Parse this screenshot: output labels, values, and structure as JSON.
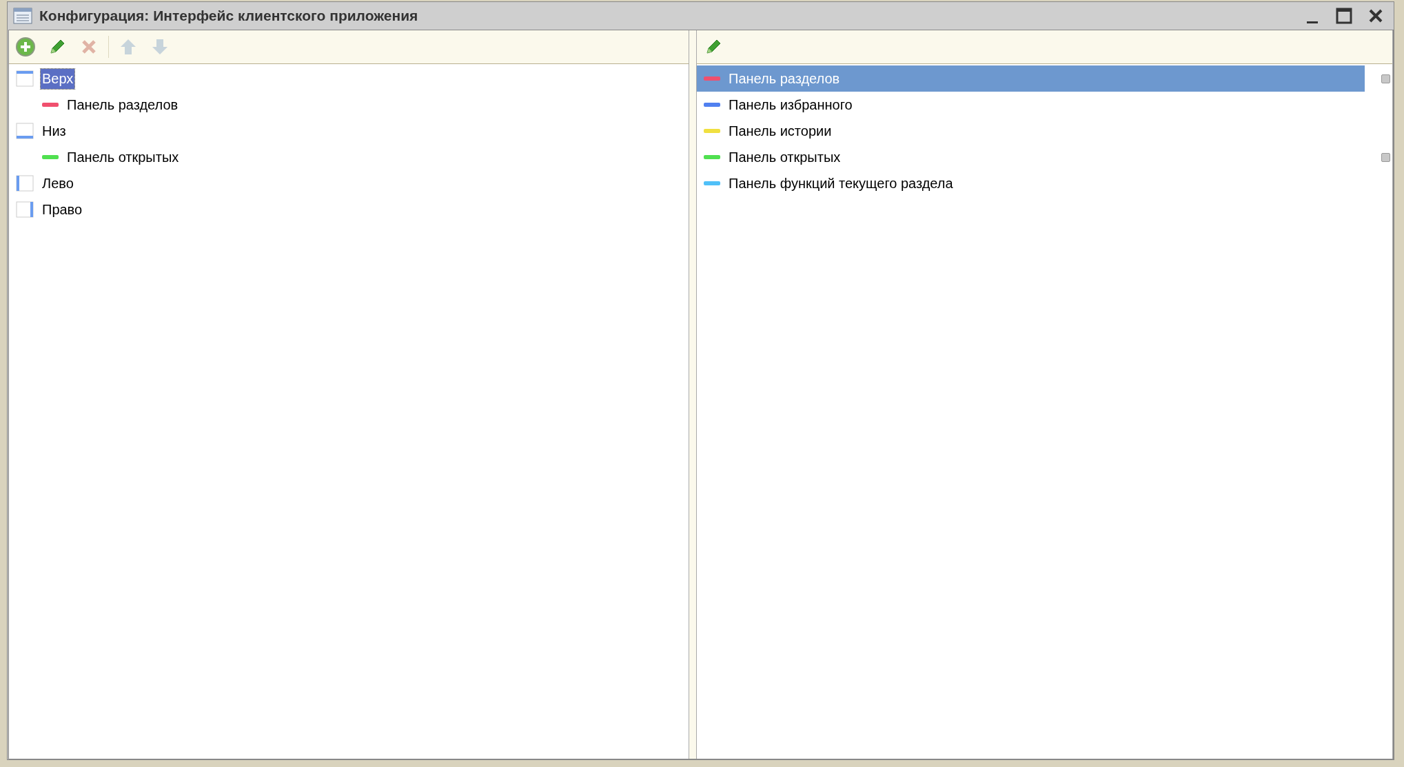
{
  "window": {
    "title": "Конфигурация: Интерфейс клиентского приложения"
  },
  "left_toolbar": [
    {
      "kind": "add",
      "disabled": false
    },
    {
      "kind": "edit",
      "disabled": false
    },
    {
      "kind": "delete",
      "disabled": true
    },
    {
      "kind": "up",
      "disabled": true
    },
    {
      "kind": "down",
      "disabled": true
    }
  ],
  "placement_tree": [
    {
      "label": "Верх",
      "kind": "top",
      "selected": true,
      "children": [
        {
          "label": "Панель разделов",
          "color": "#f0506e",
          "selected": false
        }
      ]
    },
    {
      "label": "Низ",
      "kind": "bottom",
      "selected": false,
      "children": [
        {
          "label": "Панель открытых",
          "color": "#50e050",
          "selected": false
        }
      ]
    },
    {
      "label": "Лево",
      "kind": "left",
      "selected": false
    },
    {
      "label": "Право",
      "kind": "right",
      "selected": false
    }
  ],
  "right_toolbar": [
    {
      "kind": "edit",
      "disabled": false
    }
  ],
  "panels": [
    {
      "label": "Панель разделов",
      "color": "#f0506e",
      "selected": true,
      "placed": true
    },
    {
      "label": "Панель избранного",
      "color": "#5080f0",
      "selected": false,
      "placed": false
    },
    {
      "label": "Панель истории",
      "color": "#f0e040",
      "selected": false,
      "placed": false
    },
    {
      "label": "Панель открытых",
      "color": "#50e050",
      "selected": false,
      "placed": true
    },
    {
      "label": "Панель функций текущего раздела",
      "color": "#50c0f8",
      "selected": false,
      "placed": false
    }
  ]
}
